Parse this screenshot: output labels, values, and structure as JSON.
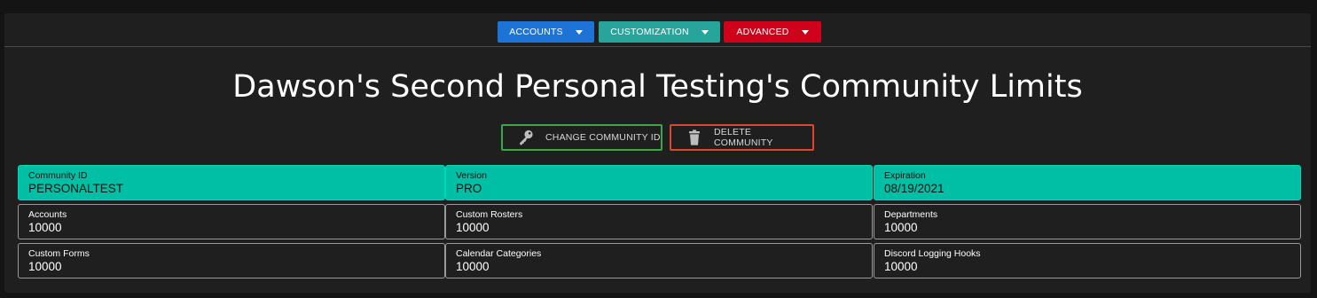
{
  "toolbar": {
    "accounts": {
      "label": "ACCOUNTS",
      "color": "#1e74d6"
    },
    "customization": {
      "label": "CUSTOMIZATION",
      "color": "#27a59a"
    },
    "advanced": {
      "label": "ADVANCED",
      "color": "#d0021b"
    }
  },
  "page": {
    "title": "Dawson's Second Personal Testing's Community Limits"
  },
  "actions": {
    "change_id": {
      "label": "CHANGE COMMUNITY ID",
      "border_color": "#3fa54a",
      "icon": "key-icon"
    },
    "delete": {
      "label": "DELETE COMMUNITY",
      "border_color": "#e0452f",
      "icon": "trash-icon"
    }
  },
  "limits": [
    {
      "label": "Community ID",
      "value": "PERSONALTEST"
    },
    {
      "label": "Version",
      "value": "PRO"
    },
    {
      "label": "Expiration",
      "value": "08/19/2021"
    },
    {
      "label": "Accounts",
      "value": "10000"
    },
    {
      "label": "Custom Rosters",
      "value": "10000"
    },
    {
      "label": "Departments",
      "value": "10000"
    },
    {
      "label": "Custom Forms",
      "value": "10000"
    },
    {
      "label": "Calendar Categories",
      "value": "10000"
    },
    {
      "label": "Discord Logging Hooks",
      "value": "10000"
    }
  ],
  "colors": {
    "accent": "#00bfa5",
    "panel": "#1f1f1f"
  }
}
